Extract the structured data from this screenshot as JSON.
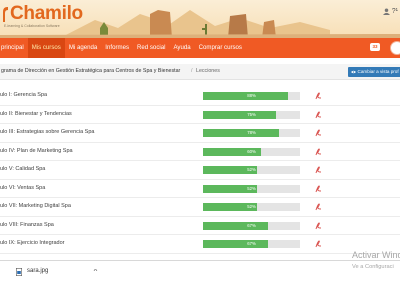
{
  "app": {
    "logo_text": "Chamilo",
    "logo_subtext": "E-learning & Collaboration Software",
    "user_label": "?¹",
    "brand_color": "#f05a24"
  },
  "nav": {
    "items": [
      {
        "label": "principal",
        "active": false
      },
      {
        "label": "Mis cursos",
        "active": true
      },
      {
        "label": "Mi agenda",
        "active": false
      },
      {
        "label": "Informes",
        "active": false
      },
      {
        "label": "Red social",
        "active": false
      },
      {
        "label": "Ayuda",
        "active": false
      },
      {
        "label": "Comprar cursos",
        "active": false
      }
    ],
    "badge": "33"
  },
  "breadcrumb": {
    "course": "grama de Dirección en Gestión Estratégica para Centros de Spa y Bienestar",
    "separator": "/",
    "current": "Lecciones"
  },
  "view_button": {
    "label": "Cambiar a vista prof",
    "icon": "eye-icon"
  },
  "lessons": [
    {
      "name": "ulo I: Gerencia Spa",
      "progress_label": "88%",
      "progress": 0.88
    },
    {
      "name": "ulo II: Bienestar y Tendencias",
      "progress_label": "75%",
      "progress": 0.75
    },
    {
      "name": "ulo III: Estrategias sobre Gerencia Spa",
      "progress_label": "78%",
      "progress": 0.78
    },
    {
      "name": "ulo IV: Plan de Marketing Spa",
      "progress_label": "60%",
      "progress": 0.6
    },
    {
      "name": "ulo V: Calidad Spa",
      "progress_label": "52%",
      "progress": 0.56
    },
    {
      "name": "ulo VI: Ventas Spa",
      "progress_label": "52%",
      "progress": 0.56
    },
    {
      "name": "ulo VII: Marketing Digital Spa",
      "progress_label": "52%",
      "progress": 0.56
    },
    {
      "name": "ulo VIII: Finanzas Spa",
      "progress_label": "67%",
      "progress": 0.67
    },
    {
      "name": "ulo IX: Ejercicio Integrador",
      "progress_label": "67%",
      "progress": 0.67
    }
  ],
  "watermark": {
    "title": "Activar Wind",
    "subtitle": "Ve a Configuraci"
  },
  "download": {
    "filename": "sara.jpg",
    "chevron": "^"
  }
}
